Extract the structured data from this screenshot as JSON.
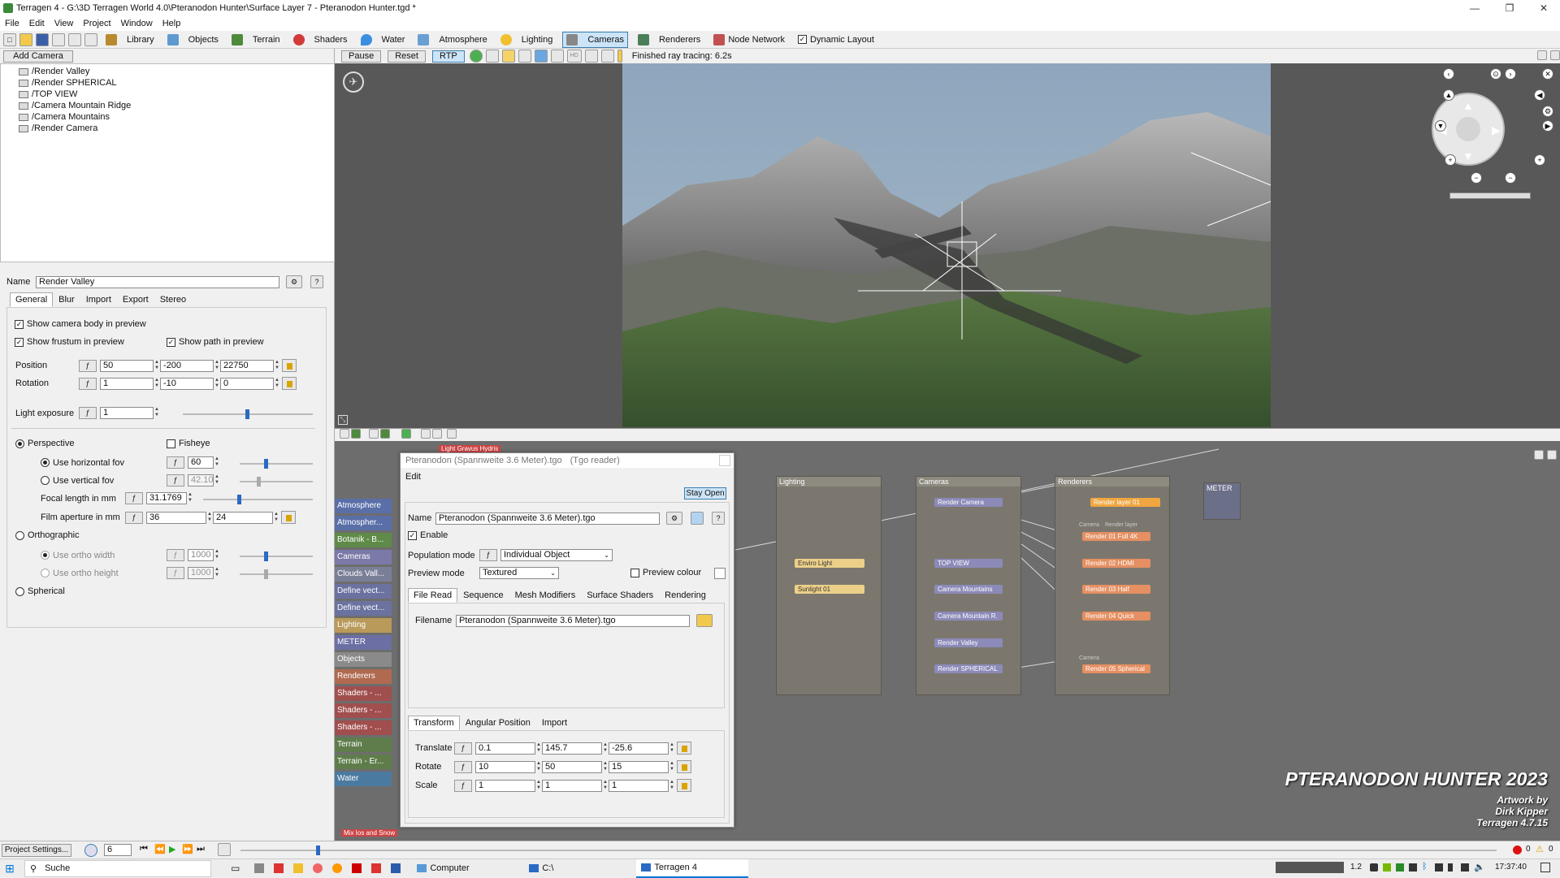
{
  "window": {
    "title": "Terragen 4 - G:\\3D Terragen World 4.0\\Pteranodon Hunter\\Surface Layer 7 - Pteranodon Hunter.tgd *",
    "controls": [
      "—",
      "❐",
      "✕"
    ]
  },
  "menu": [
    "File",
    "Edit",
    "View",
    "Project",
    "Window",
    "Help"
  ],
  "toolbar": {
    "buttons": [
      {
        "label": "Library",
        "icon": "library-icon"
      },
      {
        "label": "Objects",
        "icon": "objects-icon"
      },
      {
        "label": "Terrain",
        "icon": "terrain-icon"
      },
      {
        "label": "Shaders",
        "icon": "shaders-icon"
      },
      {
        "label": "Water",
        "icon": "water-icon"
      },
      {
        "label": "Atmosphere",
        "icon": "atmosphere-icon"
      },
      {
        "label": "Lighting",
        "icon": "lighting-icon"
      },
      {
        "label": "Cameras",
        "icon": "cameras-icon",
        "active": true
      },
      {
        "label": "Renderers",
        "icon": "renderers-icon"
      },
      {
        "label": "Node Network",
        "icon": "node-network-icon"
      }
    ],
    "dynamic_layout_label": "Dynamic Layout",
    "dynamic_layout_checked": true
  },
  "camera_panel": {
    "add_camera_label": "Add Camera",
    "cameras": [
      "/Render Valley",
      "/Render SPHERICAL",
      "/TOP VIEW",
      "/Camera Mountain Ridge",
      "/Camera Mountains",
      "/Render Camera"
    ],
    "name_label": "Name",
    "name_value": "Render Valley",
    "help_label": "?",
    "tabs": [
      "General",
      "Blur",
      "Import",
      "Export",
      "Stereo"
    ],
    "show_body_label": "Show camera body in preview",
    "show_frustum_label": "Show frustum in preview",
    "show_path_label": "Show path in preview",
    "position_label": "Position",
    "position": [
      "50",
      "-200",
      "22750"
    ],
    "rotation_label": "Rotation",
    "rotation": [
      "1",
      "-10",
      "0"
    ],
    "light_exposure_label": "Light exposure",
    "light_exposure": "1",
    "light_exposure_slider": 0.48,
    "perspective_label": "Perspective",
    "fisheye_label": "Fisheye",
    "use_h_fov_label": "Use horizontal fov",
    "h_fov": "60",
    "h_fov_slider": 0.33,
    "use_v_fov_label": "Use vertical fov",
    "v_fov": "42.103",
    "v_fov_slider": 0.23,
    "focal_length_label": "Focal length in mm",
    "focal_length": "31.1769",
    "focal_slider": 0.31,
    "film_aperture_label": "Film aperture in mm",
    "film_aperture": [
      "36",
      "24"
    ],
    "orthographic_label": "Orthographic",
    "ortho_width_label": "Use ortho width",
    "ortho_width": "1000",
    "ortho_width_slider": 0.33,
    "ortho_height_label": "Use ortho height",
    "ortho_height": "1000",
    "ortho_height_slider": 0.33,
    "spherical_label": "Spherical"
  },
  "viewport": {
    "pause_label": "Pause",
    "reset_label": "Reset",
    "rtp_label": "RTP",
    "hd_label": "HD",
    "status": "Finished ray tracing: 6.2s"
  },
  "node_network": {
    "side_categories": [
      {
        "label": "Atmosphere",
        "color": "#5a6fa8"
      },
      {
        "label": "Atmospher...",
        "color": "#5a6fa8"
      },
      {
        "label": "Botanik - B...",
        "color": "#5f8a48"
      },
      {
        "label": "Cameras",
        "color": "#7a79a8"
      },
      {
        "label": "Clouds Vall...",
        "color": "#7a7f98"
      },
      {
        "label": "Define vect...",
        "color": "#6b72a0"
      },
      {
        "label": "Define vect...",
        "color": "#6b72a0"
      },
      {
        "label": "Lighting",
        "color": "#b99a5a"
      },
      {
        "label": "METER",
        "color": "#6b6fa3"
      },
      {
        "label": "Objects",
        "color": "#8a8a8a"
      },
      {
        "label": "Renderers",
        "color": "#b06a4f"
      },
      {
        "label": "Shaders - ...",
        "color": "#a14e4e"
      },
      {
        "label": "Shaders - ...",
        "color": "#a14e4e"
      },
      {
        "label": "Shaders - ...",
        "color": "#a14e4e"
      },
      {
        "label": "Terrain",
        "color": "#5f7d4b"
      },
      {
        "label": "Terrain - Er...",
        "color": "#5f7d4b"
      },
      {
        "label": "Water",
        "color": "#4b7aa0"
      }
    ],
    "groups": {
      "lighting": {
        "title": "Lighting",
        "nodes": [
          "Enviro Light",
          "Sunlight 01"
        ]
      },
      "cameras": {
        "title": "Cameras",
        "nodes": [
          "Render Camera",
          "TOP VIEW",
          "Camera Mountains",
          "Camera Mountain R.",
          "Render Valley",
          "Render SPHERICAL"
        ]
      },
      "renderers": {
        "title": "Renderers",
        "nodes": [
          "Render layer 01",
          "Render 01 Full 4K",
          "Render 02 HDMI",
          "Render 03 Half",
          "Render 04 Quick",
          "Render 05 Spherical"
        ],
        "camera_tag": "Camera",
        "layer_tag": "Render layer"
      },
      "meter": {
        "title": "METER"
      }
    },
    "overlay_top": "Light Gravus Hydris",
    "overlay_bottom": "Mix Ios and Snow"
  },
  "dialog": {
    "title": "Pteranodon (Spannweite 3.6 Meter).tgo",
    "subtitle": "(Tgo reader)",
    "edit_menu": "Edit",
    "stay_open_label": "Stay Open",
    "name_label": "Name",
    "name_value": "Pteranodon (Spannweite 3.6 Meter).tgo",
    "help_label": "?",
    "enable_label": "Enable",
    "population_mode_label": "Population mode",
    "population_mode": "Individual Object",
    "preview_mode_label": "Preview mode",
    "preview_mode": "Textured",
    "preview_colour_label": "Preview colour",
    "tabs": [
      "File Read",
      "Sequence",
      "Mesh Modifiers",
      "Surface Shaders",
      "Rendering"
    ],
    "filename_label": "Filename",
    "filename": "Pteranodon (Spannweite 3.6 Meter).tgo",
    "transform_tabs": [
      "Transform",
      "Angular Position",
      "Import"
    ],
    "translate_label": "Translate",
    "translate": [
      "0.1",
      "145.7",
      "-25.6"
    ],
    "rotate_label": "Rotate",
    "rotate": [
      "10",
      "50",
      "15"
    ],
    "scale_label": "Scale",
    "scale": [
      "1",
      "1",
      "1"
    ]
  },
  "watermark": {
    "title": "PTERANODON HUNTER 2023",
    "line1": "Artwork by",
    "line2": "Dirk Kipper",
    "line3": "Terragen 4.7.15"
  },
  "bottom_bar": {
    "project_settings_label": "Project Settings...",
    "frame": "6",
    "timeline_position": 0.06,
    "error_count": "0",
    "warning_count": "0"
  },
  "taskbar": {
    "search_label": "Suche",
    "apps": [
      {
        "label": "Computer",
        "icon": "computer-icon"
      },
      {
        "label": "C:\\",
        "icon": "folder-icon"
      },
      {
        "label": "Terragen 4",
        "icon": "terragen-icon",
        "active": true
      }
    ],
    "tray_number": "1.2",
    "clock": "17:37:40"
  }
}
